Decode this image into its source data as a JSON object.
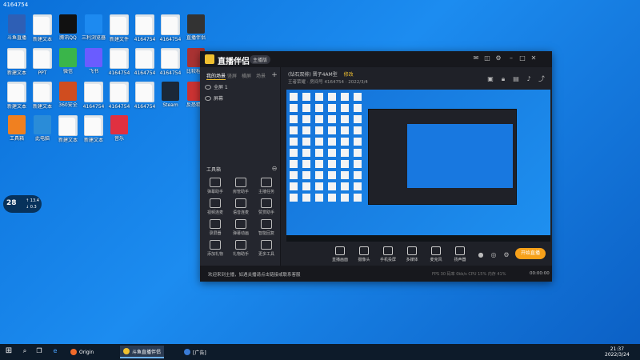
{
  "desktop": {
    "corner_label": "4164754",
    "icons": [
      {
        "label": "斗鱼直播",
        "kind": "app",
        "color": "#2e5fb5"
      },
      {
        "label": "新建文本",
        "kind": "file"
      },
      {
        "label": "腾讯QQ",
        "kind": "app",
        "color": "#111"
      },
      {
        "label": "三利浏览器",
        "kind": "app",
        "color": "#1d8af0"
      },
      {
        "label": "新建文件",
        "kind": "file"
      },
      {
        "label": "4164754",
        "kind": "file"
      },
      {
        "label": "4164754",
        "kind": "file"
      },
      {
        "label": "直播伴侣",
        "kind": "app",
        "color": "#333"
      },
      {
        "label": "新建文本",
        "kind": "file"
      },
      {
        "label": "PPT",
        "kind": "file"
      },
      {
        "label": "微信",
        "kind": "app",
        "color": "#3ab54a"
      },
      {
        "label": "飞书",
        "kind": "app",
        "color": "#6a5cff"
      },
      {
        "label": "4164754",
        "kind": "file"
      },
      {
        "label": "4164754",
        "kind": "file"
      },
      {
        "label": "4164754",
        "kind": "file"
      },
      {
        "label": "比较程序",
        "kind": "app",
        "color": "#a33"
      },
      {
        "label": "新建文本",
        "kind": "file"
      },
      {
        "label": "新建文本",
        "kind": "file"
      },
      {
        "label": "360安全",
        "kind": "app",
        "color": "#d04d1f"
      },
      {
        "label": "4164754",
        "kind": "file"
      },
      {
        "label": "4164754",
        "kind": "file"
      },
      {
        "label": "4164754",
        "kind": "file"
      },
      {
        "label": "Steam",
        "kind": "app",
        "color": "#1b2838"
      },
      {
        "label": "反恐精英",
        "kind": "app",
        "color": "#c33"
      },
      {
        "label": "工具箱",
        "kind": "app",
        "color": "#f08020"
      },
      {
        "label": "此电脑",
        "kind": "app",
        "color": "#2a8cd8"
      },
      {
        "label": "新建文本",
        "kind": "file"
      },
      {
        "label": "新建文本",
        "kind": "file"
      },
      {
        "label": "音乐",
        "kind": "app",
        "color": "#e03040"
      }
    ]
  },
  "app": {
    "title": "直播伴侣",
    "version": "主播版",
    "scene_tabs": [
      "我的场景",
      "竖屏",
      "横屏",
      "场景"
    ],
    "scenes": [
      "全屏 1",
      "屏幕"
    ],
    "tools_label": "工具箱",
    "tools": [
      "弹幕助手",
      "房管助手",
      "主播任务",
      "视频连麦",
      "语音连麦",
      "赞赏助手",
      "录屏器",
      "弹幕动画",
      "智能回复",
      "添加礼物",
      "礼物助手",
      "更多工具"
    ],
    "room_title": "(钻石双排) 晋子4AM型",
    "room_tag": "修改",
    "room_meta": "王者荣耀 · 房间号 4164754 · 2022/3/4",
    "bottom_tools": [
      "直播画面",
      "摄像头",
      "手机投屏",
      "多媒体",
      "麦克风",
      "扬声器"
    ],
    "start_live": "开始直播",
    "status_msg": "欢迎来到主播，如遇关播请点击链接或联系客服",
    "status_stats": "FPS 30   码率 0kb/s   CPU 15%   内存 41%",
    "status_time": "00:00:00"
  },
  "widget": {
    "pct": "28",
    "up": "↑ 13.4",
    "down": "↓ 0.3"
  },
  "taskbar": {
    "apps": [
      {
        "label": "Origin",
        "color": "#f06a2a"
      },
      {
        "label": "斗鱼直播伴侣",
        "color": "#f0c030"
      },
      {
        "label": "[广告]",
        "color": "#3a7bd5"
      }
    ],
    "time": "21:37",
    "date": "2022/3/24"
  }
}
